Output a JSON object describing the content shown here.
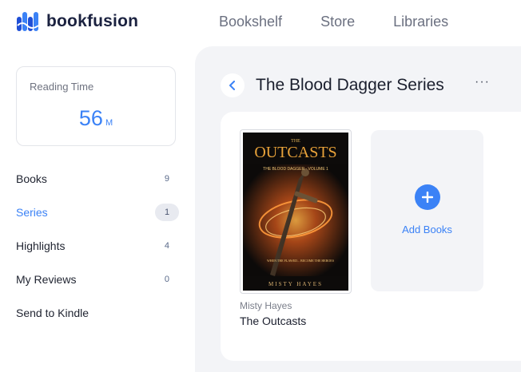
{
  "header": {
    "logo_text": "bookfusion",
    "nav": [
      "Bookshelf",
      "Store",
      "Libraries"
    ]
  },
  "sidebar": {
    "reading_time": {
      "label": "Reading Time",
      "value": "56",
      "unit": "M"
    },
    "items": [
      {
        "label": "Books",
        "count": "9"
      },
      {
        "label": "Series",
        "count": "1",
        "active": true
      },
      {
        "label": "Highlights",
        "count": "4"
      },
      {
        "label": "My Reviews",
        "count": "0"
      },
      {
        "label": "Send to Kindle",
        "count": ""
      }
    ]
  },
  "main": {
    "title": "The Blood Dagger Series",
    "more": "···",
    "book": {
      "author": "Misty Hayes",
      "title": "The Outcasts",
      "cover": {
        "heading": "OUTCASTS",
        "heading_prefix": "THE",
        "subtitle": "THE BLOOD DAGGER · VOLUME 1",
        "tagline": "WHEN THE FLAWED... BECOME THE HEROES",
        "author": "MISTY HAYES"
      }
    },
    "add_books_label": "Add Books"
  },
  "colors": {
    "accent": "#3b82f6",
    "panel_bg": "#f3f4f7"
  }
}
